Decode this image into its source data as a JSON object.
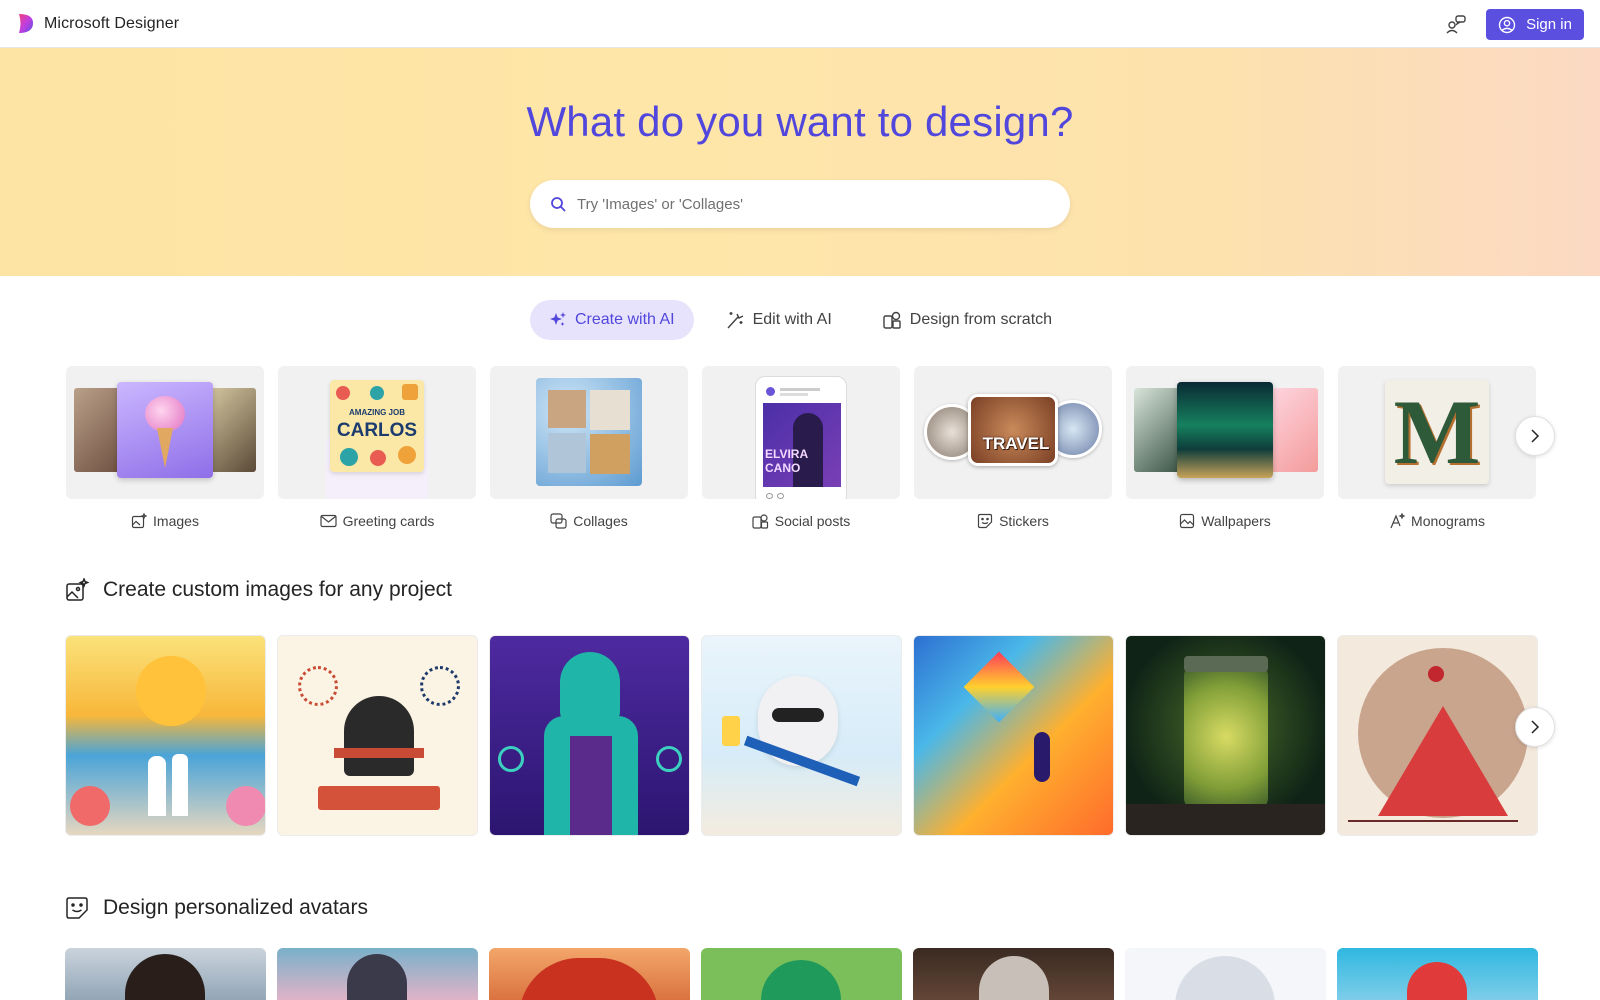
{
  "app": {
    "name": "Microsoft Designer"
  },
  "header": {
    "signin_label": "Sign in",
    "feedback_icon": "people-icon",
    "accent": "#5b4fe0"
  },
  "hero": {
    "title": "What do you want to design?",
    "search_placeholder": "Try 'Images' or 'Collages'",
    "search_value": ""
  },
  "tabs": [
    {
      "label": "Create with AI",
      "icon": "sparkle-icon",
      "active": true
    },
    {
      "label": "Edit with AI",
      "icon": "wand-icon",
      "active": false
    },
    {
      "label": "Design from scratch",
      "icon": "shapes-icon",
      "active": false
    }
  ],
  "categories": [
    {
      "label": "Images",
      "icon": "image-sparkle-icon"
    },
    {
      "label": "Greeting cards",
      "icon": "mail-icon",
      "card_lines": [
        "AMAZING JOB",
        "CARLOS"
      ]
    },
    {
      "label": "Collages",
      "icon": "collage-icon"
    },
    {
      "label": "Social posts",
      "icon": "social-icon",
      "post_name": [
        "ELVIRA",
        "CANO"
      ]
    },
    {
      "label": "Stickers",
      "icon": "sticker-icon",
      "sticker_text": "TRAVEL"
    },
    {
      "label": "Wallpapers",
      "icon": "wallpaper-icon"
    },
    {
      "label": "Monograms",
      "icon": "monogram-icon",
      "letter": "M"
    }
  ],
  "sections": [
    {
      "title": "Create custom images for any project",
      "icon": "image-sparkle-icon",
      "tiles": [
        "tropical-wedding-papercraft",
        "liberty-bell-fireworks",
        "gymnast-rings",
        "yeti-beach-chair",
        "kite-runner-lowpoly",
        "firefly-jar",
        "indian-dancer"
      ]
    },
    {
      "title": "Design personalized avatars",
      "icon": "sticker-icon",
      "tiles": [
        "city-woman",
        "dj-headphones",
        "red-hair-girl",
        "golfer-cap",
        "sunglasses-man",
        "silver-hair-woman",
        "ferris-wheel"
      ]
    }
  ],
  "colors": {
    "brand_purple": "#5147dc",
    "tab_active_bg": "#e8e3fc"
  }
}
